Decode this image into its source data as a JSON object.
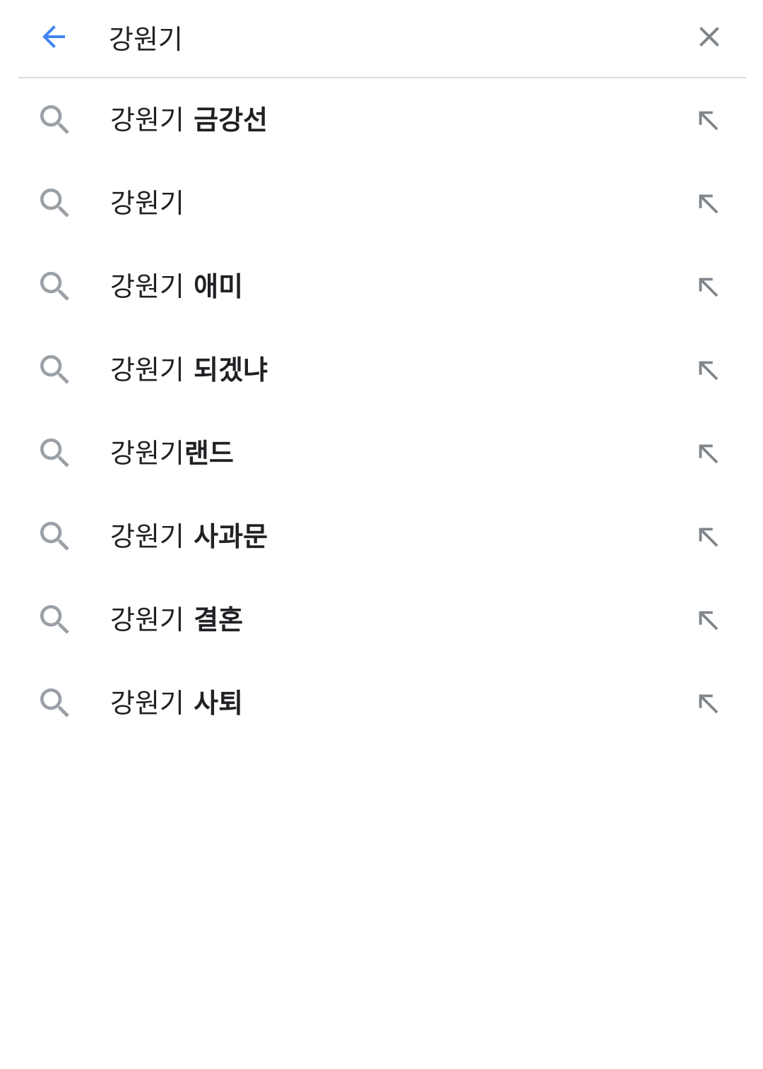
{
  "search": {
    "query": "강원기",
    "back_icon": "arrow-back-icon",
    "clear_icon": "close-icon"
  },
  "colors": {
    "accent": "#4285f4",
    "icon_gray": "#80868b",
    "text": "#202124",
    "divider": "#dadce0"
  },
  "suggestions": [
    {
      "prefix": "강원기",
      "completion": " 금강선"
    },
    {
      "prefix": "강원기",
      "completion": ""
    },
    {
      "prefix": "강원기",
      "completion": " 애미"
    },
    {
      "prefix": "강원기",
      "completion": " 되겠냐"
    },
    {
      "prefix": "강원기",
      "completion": "랜드"
    },
    {
      "prefix": "강원기",
      "completion": " 사과문"
    },
    {
      "prefix": "강원기",
      "completion": " 결혼"
    },
    {
      "prefix": "강원기",
      "completion": " 사퇴"
    }
  ]
}
